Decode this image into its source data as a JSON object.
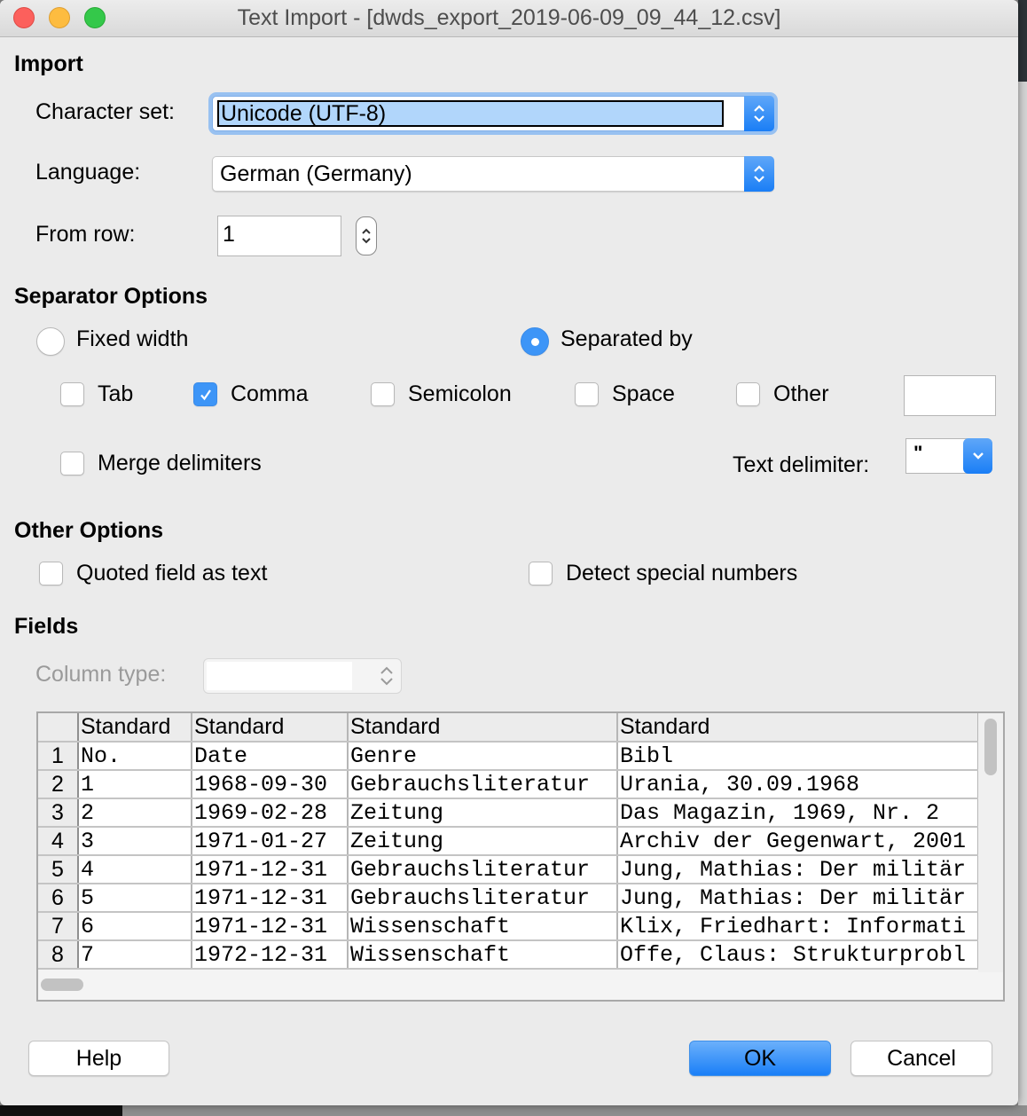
{
  "window": {
    "title": "Text Import - [dwds_export_2019-06-09_09_44_12.csv]"
  },
  "import": {
    "section_title": "Import",
    "charset_label": "Character set:",
    "charset_value": "Unicode (UTF-8)",
    "language_label": "Language:",
    "language_value": "German (Germany)",
    "from_row_label": "From row:",
    "from_row_value": "1"
  },
  "separator": {
    "section_title": "Separator Options",
    "fixed_width_label": "Fixed width",
    "fixed_width_selected": false,
    "separated_by_label": "Separated by",
    "separated_by_selected": true,
    "options": [
      {
        "label": "Tab",
        "checked": false
      },
      {
        "label": "Comma",
        "checked": true
      },
      {
        "label": "Semicolon",
        "checked": false
      },
      {
        "label": "Space",
        "checked": false
      },
      {
        "label": "Other",
        "checked": false
      }
    ],
    "other_value": "",
    "merge_label": "Merge delimiters",
    "merge_checked": false,
    "text_delimiter_label": "Text delimiter:",
    "text_delimiter_value": "\""
  },
  "other_options": {
    "section_title": "Other Options",
    "quoted_label": "Quoted field as text",
    "quoted_checked": false,
    "detect_label": "Detect special numbers",
    "detect_checked": false
  },
  "fields": {
    "section_title": "Fields",
    "column_type_label": "Column type:",
    "column_type_value": "",
    "columns": [
      "Standard",
      "Standard",
      "Standard",
      "Standard"
    ],
    "rows": [
      {
        "n": "1",
        "cells": [
          "No.",
          "Date",
          "Genre",
          "Bibl"
        ]
      },
      {
        "n": "2",
        "cells": [
          "1",
          "1968-09-30",
          "Gebrauchsliteratur",
          "Urania, 30.09.1968"
        ]
      },
      {
        "n": "3",
        "cells": [
          "2",
          "1969-02-28",
          "Zeitung",
          "Das Magazin, 1969, Nr. 2"
        ]
      },
      {
        "n": "4",
        "cells": [
          "3",
          "1971-01-27",
          "Zeitung",
          "Archiv der Gegenwart, 2001"
        ]
      },
      {
        "n": "5",
        "cells": [
          "4",
          "1971-12-31",
          "Gebrauchsliteratur",
          "Jung, Mathias: Der militär"
        ]
      },
      {
        "n": "6",
        "cells": [
          "5",
          "1971-12-31",
          "Gebrauchsliteratur",
          "Jung, Mathias: Der militär"
        ]
      },
      {
        "n": "7",
        "cells": [
          "6",
          "1971-12-31",
          "Wissenschaft",
          "Klix, Friedhart: Informati"
        ]
      },
      {
        "n": "8",
        "cells": [
          "7",
          "1972-12-31",
          "Wissenschaft",
          "Offe, Claus: Strukturprobl"
        ]
      }
    ]
  },
  "buttons": {
    "help": "Help",
    "ok": "OK",
    "cancel": "Cancel"
  },
  "colors": {
    "accent": "#1a7ff7",
    "selection": "#b1d6fb",
    "dialog_bg": "#ebebeb"
  }
}
